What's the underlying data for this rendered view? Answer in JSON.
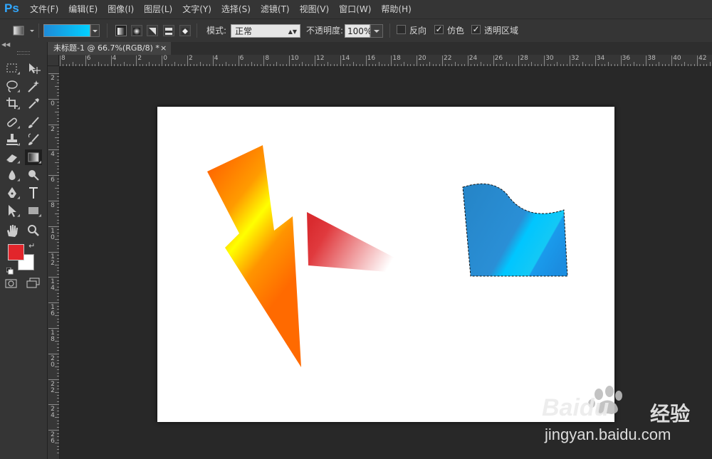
{
  "app": {
    "logo": "Ps"
  },
  "menu": [
    "文件(F)",
    "编辑(E)",
    "图像(I)",
    "图层(L)",
    "文字(Y)",
    "选择(S)",
    "滤镜(T)",
    "视图(V)",
    "窗口(W)",
    "帮助(H)"
  ],
  "options": {
    "mode_label": "模式:",
    "mode_value": "正常",
    "opacity_label": "不透明度:",
    "opacity_value": "100%",
    "reverse_label": "反向",
    "reverse_checked": false,
    "dither_label": "仿色",
    "dither_checked": true,
    "transparency_label": "透明区域",
    "transparency_checked": true,
    "gradient_colors": [
      "#1f8bd8",
      "#00d0ff"
    ]
  },
  "document": {
    "tab_title": "未标题-1 @ 66.7%(RGB/8) *",
    "close": "×"
  },
  "rulers": {
    "h_labels": [
      "8",
      "6",
      "4",
      "2",
      "0",
      "2",
      "4",
      "6",
      "8",
      "10",
      "12",
      "14",
      "16",
      "18",
      "20",
      "22",
      "24",
      "26",
      "28",
      "30",
      "32",
      "34",
      "36",
      "38",
      "40",
      "42"
    ],
    "v_labels": [
      "2",
      "0",
      "2",
      "4",
      "6",
      "8",
      "1 0",
      "1 2",
      "1 4",
      "1 6",
      "1 8",
      "2 0",
      "2 2",
      "2 4",
      "2 6"
    ]
  },
  "colors": {
    "foreground": "#e2252b",
    "background": "#ffffff",
    "accent": "#31a8ff"
  },
  "watermark": {
    "brand": "Baidu",
    "brand_cn": "经验",
    "url": "jingyan.baidu.com"
  }
}
